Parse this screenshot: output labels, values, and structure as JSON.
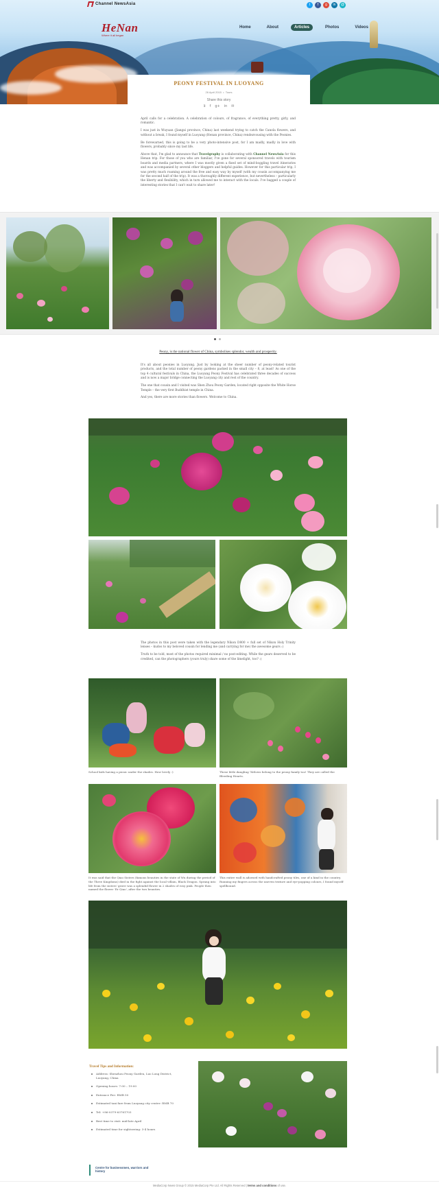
{
  "brand": {
    "name": "Channel NewsAsia"
  },
  "logo": {
    "main": "HeNan",
    "sub": "Where it all began"
  },
  "social_top": [
    {
      "icon": "twitter-icon",
      "glyph": "t",
      "color": "#1da1f2"
    },
    {
      "icon": "facebook-icon",
      "glyph": "f",
      "color": "#3b5998"
    },
    {
      "icon": "google-plus-icon",
      "glyph": "g",
      "color": "#dd4b39"
    },
    {
      "icon": "linkedin-icon",
      "glyph": "in",
      "color": "#0e76a8"
    },
    {
      "icon": "email-icon",
      "glyph": "@",
      "color": "#19b5c7"
    }
  ],
  "nav": {
    "items": [
      {
        "label": "Home"
      },
      {
        "label": "About"
      },
      {
        "label": "Articles"
      },
      {
        "label": "Photos"
      },
      {
        "label": "Videos"
      }
    ],
    "active": "Articles"
  },
  "post": {
    "title": "PEONY FESTIVAL IN LUOYANG",
    "date": "26 April 2015",
    "separator": "•",
    "category": "Tours",
    "share_label": "Share this story",
    "share_icons": [
      "twitter-icon",
      "facebook-icon",
      "google-plus-icon",
      "linkedin-icon",
      "email-icon"
    ]
  },
  "intro": {
    "p1": "April calls for a celebration. A celebration of colours, of fragrance, of everything pretty, girly, and romantic.",
    "p2": "I was just in Wuyuan (Jiangxi province, China) last weekend trying to catch the Canola flowers, and without a break, I found myself in Luoyang (Henan province, China) rendezvousing with the Peonies.",
    "p3": "Be forewarned, this is going to be a very photo-intensive post, for I am madly, madly in love with flowers, probably since my last life.",
    "p4_a": "Above that, I'm glad to announce that ",
    "p4_link1": "Travelgraphy",
    "p4_b": " is collaborating with ",
    "p4_link2": "Channel NewsAsia",
    "p4_c": " for this Henan trip. For those of you who are familiar, I've gone for several sponsored travels with tourism boards and media partners, where I was mostly given a fixed set of mind-boggling travel itineraries and was accompanied by several other bloggers and helpful guides. However for this particular trip, I was pretty much roaming around the free and easy way by myself (with my cousin accompanying me for the second half of the trip). It was a thoroughly different experience, but nevertheless – particularly the liberty and flexibility, which in turn allowed me to interact with the locals. I've bagged a couple of interesting stories that I can't wait to share later!"
  },
  "tagline": "Peony, is the national flower of China, symbolises splendor, wealth and prosperity.",
  "body2": {
    "p1": "It's all about peonies in Luoyang. Just by looking at the sheer number of peony-related tourist products, and the total number of peony gardens packed in the small city – 8, at least! As one of the top 4 cultural festivals in China, the Luoyang Peony Festival has celebrated three decades of success and is now a major bridge connecting the Luoyang city and rest of the country.",
    "p2": "The one that cousin and I visited was Shen Zhou Peony Garden, located right opposite the White Horse Temple – the very first Buddhist temple in China.",
    "p3": "And yes, there are more stories than flowers. Welcome to China."
  },
  "carousel": {
    "dots": [
      {
        "on": true
      },
      {
        "on": false
      }
    ]
  },
  "body3": {
    "p1": "The photos in this post were taken with the legendary Nikon D800 + full set of Nikon Holy Trinity lenses – kudos to my beloved cousin for lending me (and carrying for me) the awesome gears :)",
    "p2": "Truth to be told, most of the photos required minimal / no post-editing. While the gears deserved to be credited, can the photographers (yours truly) share some of the limelight, too? :)"
  },
  "captions": {
    "c1": "School kids having a picnic under the shades. How lovely :)",
    "c2": "These little dangling 'Xitlows belong to the peony family too! They are called the Bleeding Hearts.",
    "c3": "It was said that the Qiao Sisters (famous beauties in the state of Wu during the period of the Three Kingdoms) died in the fight against the local villain, Black Dragon. Sprang into life from the sisters' grave was a splendid flower in 2 shades of rosy pink. People then named the flower 'Er Qiao', after the two beauties.",
    "c4": "This entire wall is adorned with handcrafted peony tiles, one of a kind in the country. Running my fingers across the uneven texture and eye-popping colours, I found myself spellbound."
  },
  "tips": {
    "title": "Travel Tips and Information:",
    "items": [
      "Address: Shenzhou Peony Garden, Luo Long District, Luoyang, China",
      "Opening hours: 7:00 – 19:00",
      "Entrance Fee: RMB 50",
      "Estimated taxi fare from Luoyang city center: RMB 70",
      "Tel: +86-0379-63761703",
      "Best time to visit: mid-late April",
      "Estimated time for sightseeing: 3-4 hours"
    ]
  },
  "chip": {
    "label": "Centre for businessmen, warriors and history"
  },
  "footer": {
    "text": "MediaCorp News Group © 2015 MediaCorp Pte Ltd. All Rights Reserved | ",
    "link": "terms and conditions",
    "tail": " of use."
  }
}
